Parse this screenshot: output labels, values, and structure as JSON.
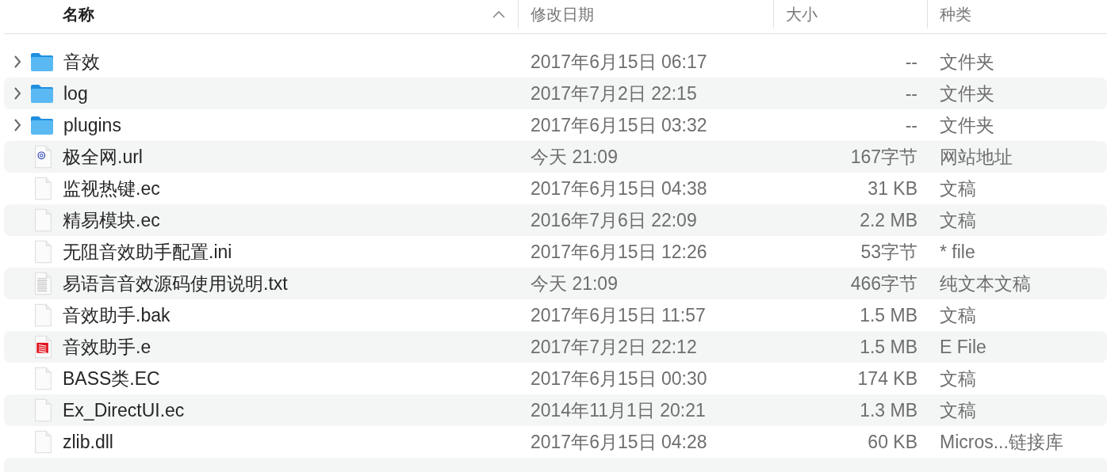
{
  "columns": [
    {
      "label": "名称",
      "sorted": true
    },
    {
      "label": "修改日期",
      "sorted": false
    },
    {
      "label": "大小",
      "sorted": false
    },
    {
      "label": "种类",
      "sorted": false
    }
  ],
  "rows": [
    {
      "kind": "folder",
      "expanded": false,
      "name": "音效",
      "date": "2017年6月15日 06:17",
      "size": "--",
      "type": "文件夹"
    },
    {
      "kind": "folder",
      "expanded": false,
      "name": "log",
      "date": "2017年7月2日 22:15",
      "size": "--",
      "type": "文件夹"
    },
    {
      "kind": "folder",
      "expanded": false,
      "name": "plugins",
      "date": "2017年6月15日 03:32",
      "size": "--",
      "type": "文件夹"
    },
    {
      "kind": "url",
      "name": "极全网.url",
      "date": "今天 21:09",
      "size": "167字节",
      "type": "网站地址"
    },
    {
      "kind": "blank",
      "name": "监视热键.ec",
      "date": "2017年6月15日 04:38",
      "size": "31 KB",
      "type": "文稿"
    },
    {
      "kind": "blank",
      "name": "精易模块.ec",
      "date": "2016年7月6日 22:09",
      "size": "2.2 MB",
      "type": "文稿"
    },
    {
      "kind": "blank",
      "name": "无阻音效助手配置.ini",
      "date": "2017年6月15日 12:26",
      "size": "53字节",
      "type": "* file"
    },
    {
      "kind": "text",
      "name": "易语言音效源码使用说明.txt",
      "date": "今天 21:09",
      "size": "466字节",
      "type": "纯文本文稿"
    },
    {
      "kind": "blank",
      "name": "音效助手.bak",
      "date": "2017年6月15日 11:57",
      "size": "1.5 MB",
      "type": "文稿"
    },
    {
      "kind": "efile",
      "name": "音效助手.e",
      "date": "2017年7月2日 22:12",
      "size": "1.5 MB",
      "type": "E File"
    },
    {
      "kind": "blank",
      "name": "BASS类.EC",
      "date": "2017年6月15日 00:30",
      "size": "174 KB",
      "type": "文稿"
    },
    {
      "kind": "blank",
      "name": "Ex_DirectUI.ec",
      "date": "2014年11月1日 20:21",
      "size": "1.3 MB",
      "type": "文稿"
    },
    {
      "kind": "blank",
      "name": "zlib.dll",
      "date": "2017年6月15日 04:28",
      "size": "60 KB",
      "type": "Micros...链接库"
    }
  ]
}
